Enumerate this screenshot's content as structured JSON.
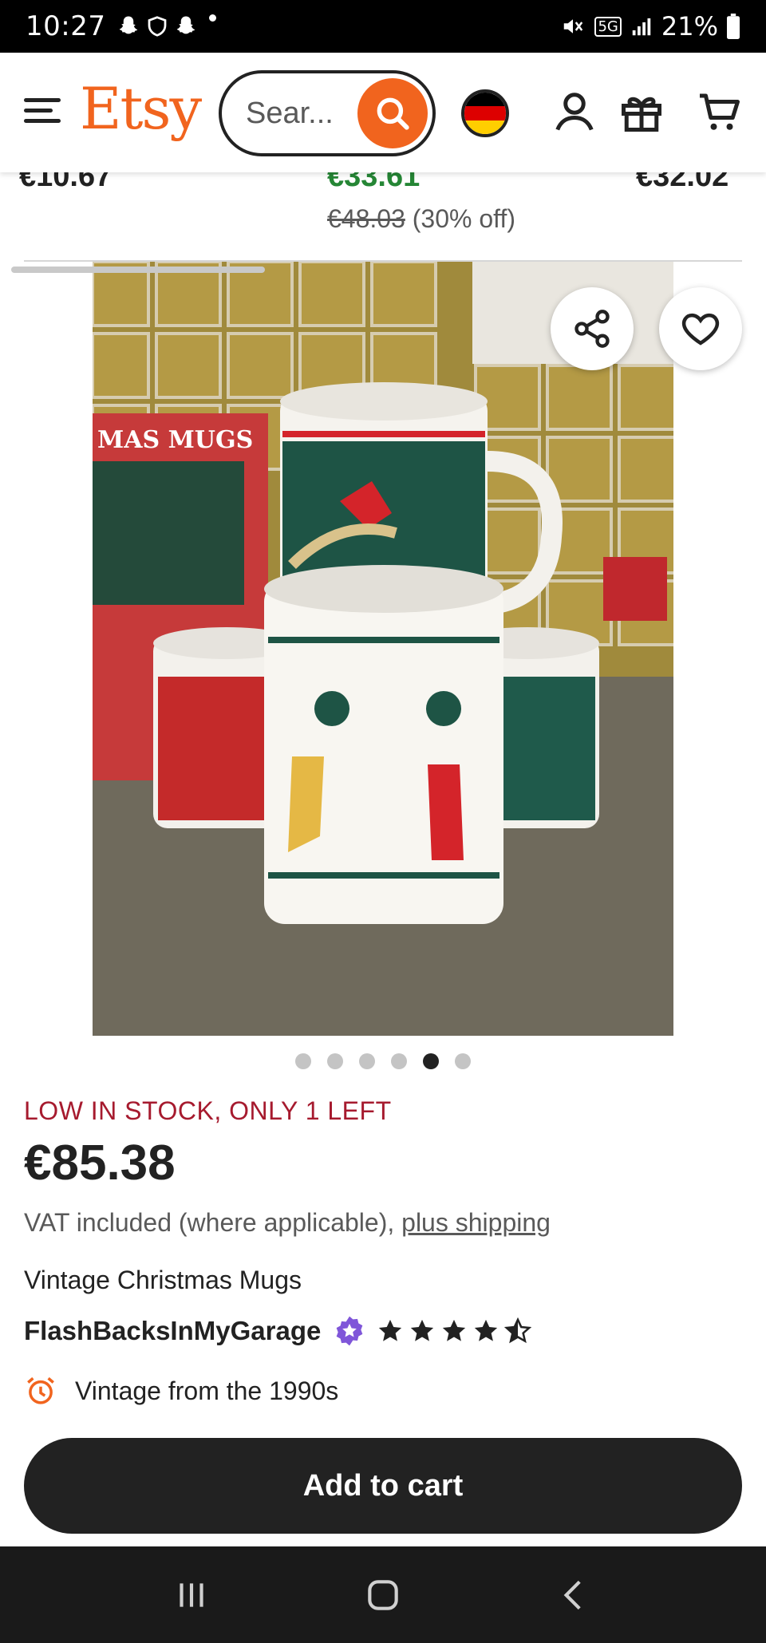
{
  "status_bar": {
    "time": "10:27",
    "battery": "21%",
    "network": "5G"
  },
  "header": {
    "logo": "Etsy",
    "search_placeholder": "Sear...",
    "region": "Germany"
  },
  "previous_row": {
    "price_left": "€10.67",
    "price_mid": "€33.61",
    "price_mid_original": "€48.03",
    "discount": "(30% off)",
    "price_right": "€32.02"
  },
  "carousel": {
    "image_count": 6,
    "active_index": 4,
    "box_text": "MAS MUGS"
  },
  "product": {
    "stock_notice": "LOW IN STOCK, ONLY 1 LEFT",
    "price": "€85.38",
    "vat_text": "VAT included (where applicable),",
    "shipping_link": "plus shipping",
    "title": "Vintage Christmas Mugs",
    "shop_name": "FlashBacksInMyGarage",
    "rating": 4.5,
    "vintage": "Vintage from the 1990s",
    "add_to_cart": "Add to cart"
  },
  "colors": {
    "brand": "#f1641e",
    "stock_red": "#a61a2e",
    "sale_green": "#258635",
    "star_seller": "#7f56d9"
  }
}
